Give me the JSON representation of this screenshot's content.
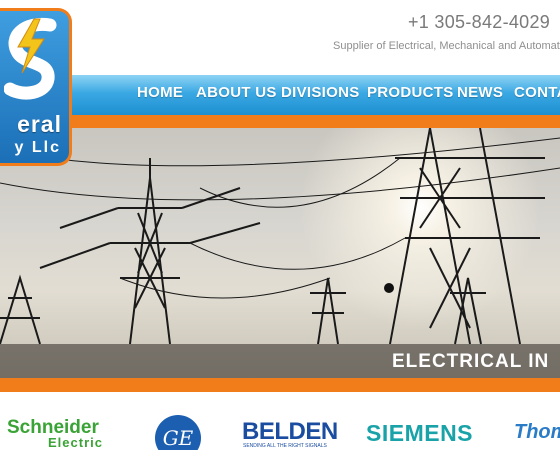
{
  "header": {
    "phone": "+1 305-842-4029",
    "tagline": "Supplier of Electrical, Mechanical and Automation"
  },
  "logo": {
    "line1": "eral",
    "line2": "y Llc"
  },
  "nav": {
    "items": [
      "HOME",
      "ABOUT US",
      "DIVISIONS",
      "PRODUCTS",
      "NEWS",
      "CONTA"
    ]
  },
  "hero": {
    "caption": "ELECTRICAL IN"
  },
  "brands": {
    "schneider_top": "Schneider",
    "schneider_bottom": "Electric",
    "ge": "GE",
    "belden": "BELDEN",
    "belden_tagline": "SENDING ALL THE RIGHT SIGNALS",
    "siemens": "SIEMENS",
    "thomas": "Thom"
  },
  "colors": {
    "nav_blue": "#2b9ad9",
    "accent_orange": "#f07d1a",
    "schneider_green": "#3aa335",
    "siemens_teal": "#19a3a8"
  }
}
